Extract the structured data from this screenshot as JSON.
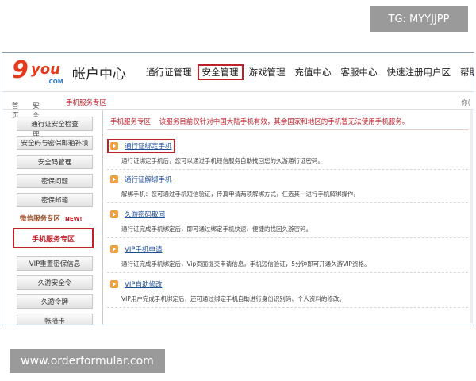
{
  "watermarks": {
    "top": "TG: MYYJJPP",
    "bottom": "www.orderformular.com"
  },
  "header": {
    "logo_digit": "9",
    "logo_text": "you",
    "logo_com": ".COM",
    "site_title": "帐户中心",
    "nav": [
      "通行证管理",
      "安全管理",
      "游戏管理",
      "充值中心",
      "客服中心",
      "快速注册用户区",
      "帮助"
    ],
    "active_nav": "安全管理"
  },
  "breadcrumb": {
    "home": "首页",
    "section": "安全管理",
    "current": "手机服务专区",
    "sep": "-",
    "right": "你("
  },
  "sidebar": {
    "items": [
      "通行证安全检查",
      "安全码与密保邮箱补填",
      "安全码管理",
      "密保问题",
      "密保邮箱"
    ],
    "wechat_label": "微信服务专区",
    "wechat_badge": "NEW!",
    "active": "手机服务专区",
    "items_below": [
      "VIP重置密保信息",
      "久游安全令",
      "久游令牌",
      "帐陪卡"
    ]
  },
  "notice": {
    "tag": "手机服务专区",
    "text": "该服务目前仅针对中国大陆手机有效，其余国家和地区的手机暂无法使用手机服务。"
  },
  "services": [
    {
      "title": "通行证绑定手机",
      "desc": "通行证绑定手机后，您可以通过手机短信服务自助找回您的久游通行证密码。"
    },
    {
      "title": "通行证解绑手机",
      "desc": "解绑手机：您可通过手机短信验证，传真申请两项解绑方式，任选其一进行手机解绑操作。"
    },
    {
      "title": "久游密码取回",
      "desc": "通行证完成手机绑定后，即可通过绑定手机快速、便捷的找回久游密码。"
    },
    {
      "title": "VIP手机申请",
      "desc": "通行证完成手机绑定后，Vip页面提交申请信息，手机短信验证，5分钟即可开通久游VIP资格。"
    },
    {
      "title": "VIP自助修改",
      "desc": "VIP用户完成手机绑定后，还可通过绑定手机自助进行身份识别码、个人资料的修改。"
    }
  ]
}
